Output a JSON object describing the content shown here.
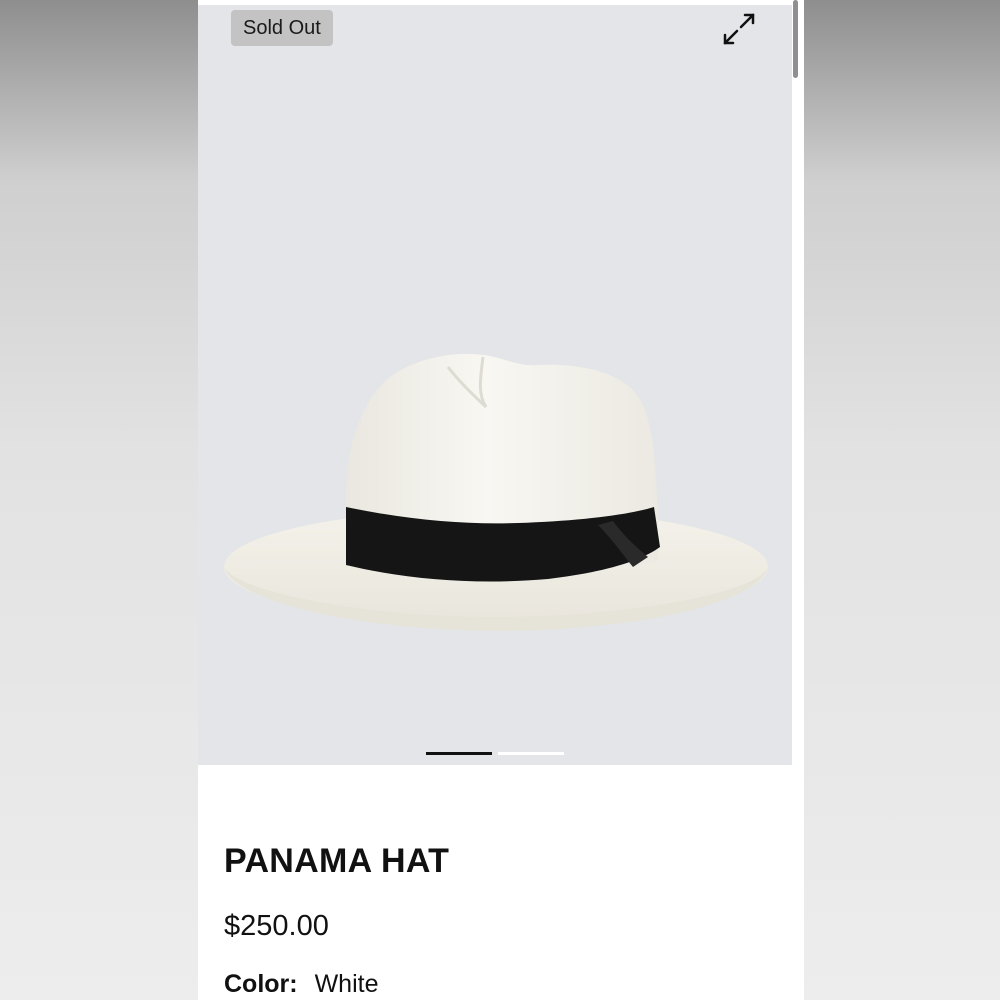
{
  "product": {
    "badge": "Sold Out",
    "title": "PANAMA HAT",
    "price": "$250.00",
    "color_label": "Color:",
    "color_value": "White",
    "image_subject": "white straw panama hat with black band"
  },
  "gallery": {
    "expand_icon": "expand-arrows-icon",
    "slides_total": 2,
    "active_slide": 1
  },
  "colors": {
    "background": "#e3e5e8",
    "badge_bg": "#c3c3c3",
    "text": "#111111",
    "hat_straw": "#f5f3ec",
    "hat_band": "#141414"
  }
}
